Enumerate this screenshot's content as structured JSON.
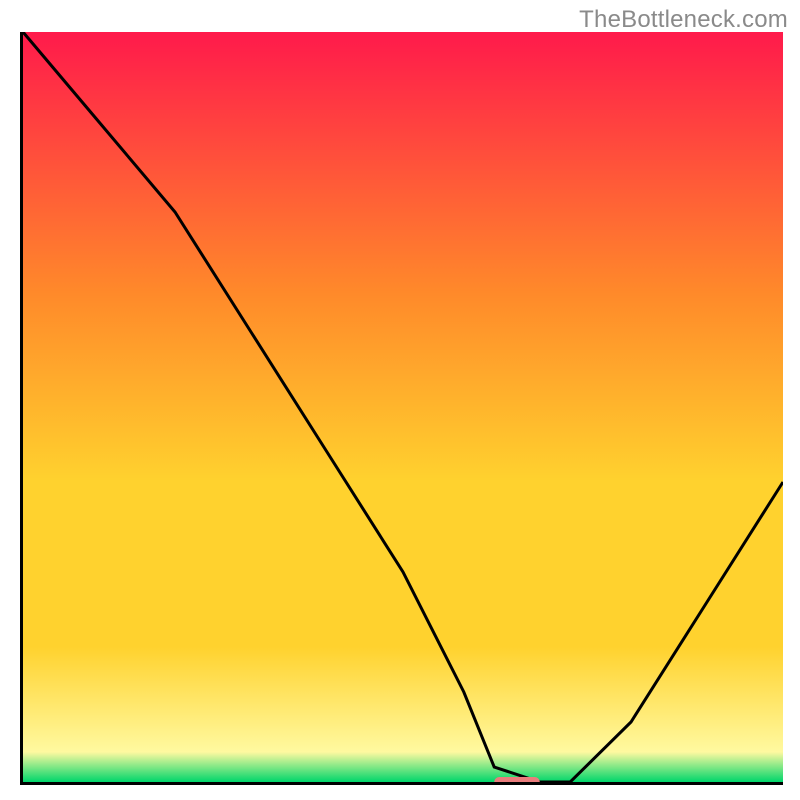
{
  "watermark": "TheBottleneck.com",
  "colors": {
    "curve": "#000000",
    "marker": "#e97c7c",
    "axis": "#000000",
    "grad_top": "#ff1a4b",
    "grad_mid1": "#ff8a2a",
    "grad_mid2": "#ffd22e",
    "grad_mid3": "#fff9a0",
    "grad_bottom": "#00d66b"
  },
  "chart_data": {
    "type": "line",
    "title": "",
    "xlabel": "",
    "ylabel": "",
    "xlim": [
      0,
      100
    ],
    "ylim": [
      0,
      100
    ],
    "x": [
      0,
      10,
      20,
      30,
      40,
      50,
      58,
      62,
      68,
      72,
      80,
      90,
      100
    ],
    "values": [
      100,
      88,
      76,
      60,
      44,
      28,
      12,
      2,
      0,
      0,
      8,
      24,
      40
    ],
    "marker": {
      "x_start": 62,
      "x_end": 68,
      "y": 0
    },
    "annotations": []
  }
}
